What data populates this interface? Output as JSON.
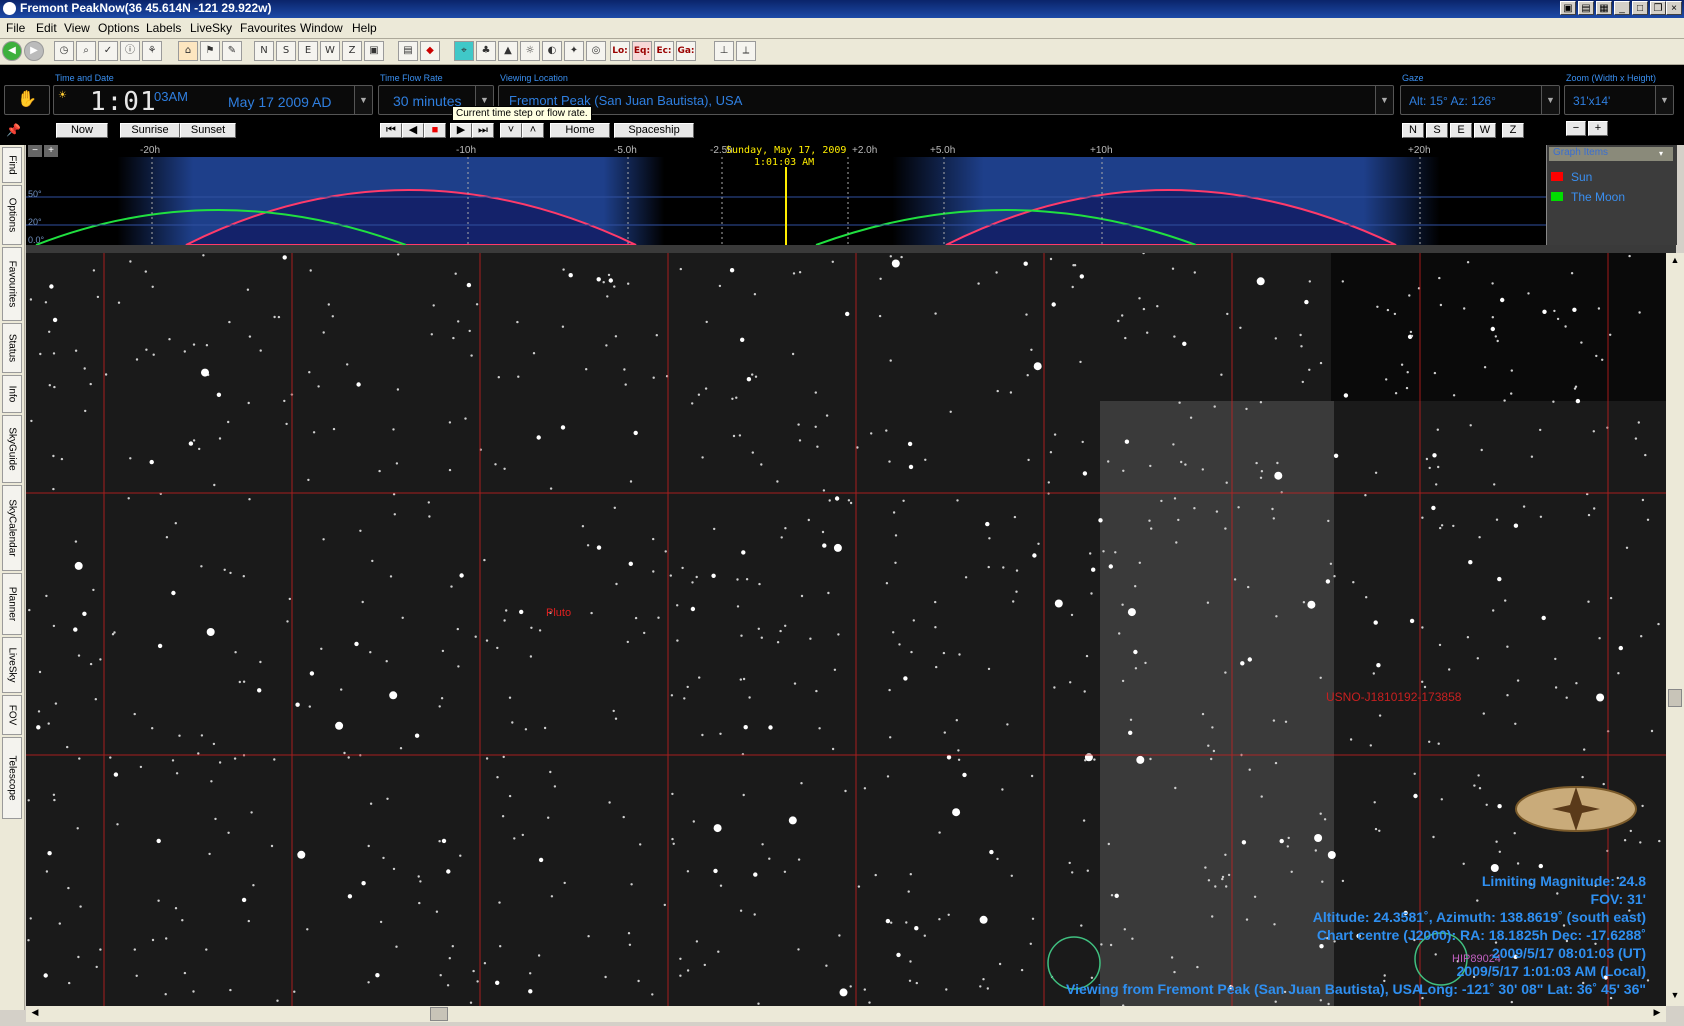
{
  "window": {
    "title": "Fremont PeakNow(36  45.614N -121 29.922w)"
  },
  "menu": [
    "File",
    "Edit",
    "View",
    "Options",
    "Labels",
    "LiveSky",
    "Favourites",
    "Window",
    "Help"
  ],
  "toolbar": {
    "icons": [
      "back-icon",
      "forward-icon",
      "refresh-icon",
      "find-icon",
      "chart-icon",
      "info-icon",
      "telescope-icon",
      "home-icon",
      "flag-icon",
      "edit-icon",
      "refresh2-icon",
      "north-icon",
      "south-icon",
      "east-icon",
      "west-icon",
      "zenith-icon",
      "frame-icon",
      "pic-icon",
      "stop-icon",
      "select-icon",
      "tree-icon",
      "mountain-icon",
      "sun-icon",
      "moon-icon",
      "constellation-icon",
      "galaxy-icon"
    ],
    "text_buttons": [
      "Lo:",
      "Eq:",
      "Ec:",
      "Ga:"
    ]
  },
  "controls": {
    "time_label": "Time and Date",
    "time_value": "1:01",
    "time_suffix": "03AM",
    "date_value": "May 17   2009 AD",
    "flow_label": "Time Flow Rate",
    "flow_value": "30 minutes",
    "flow_tooltip": "Current time step or flow rate.",
    "location_label": "Viewing Location",
    "location_value": "Fremont Peak (San Juan Bautista), USA",
    "gaze_label": "Gaze",
    "gaze_value": "Alt: 15° Az: 126°",
    "zoom_label": "Zoom (Width x Height)",
    "zoom_value": "31'x14'",
    "now": "Now",
    "sunrise": "Sunrise",
    "sunset": "Sunset",
    "home": "Home",
    "spaceship": "Spaceship",
    "compass": [
      "N",
      "S",
      "E",
      "W",
      "Z"
    ],
    "zoom_minus": "−",
    "zoom_plus": "+"
  },
  "sidetabs": [
    "Find",
    "Options",
    "Favourites",
    "Status",
    "Info",
    "SkyGuide",
    "SkyCalendar",
    "Planner",
    "LiveSky",
    "FOV",
    "Telescope"
  ],
  "graph": {
    "ticks": [
      "-20h",
      "-10h",
      "-5.0h",
      "-2.5h",
      "+2.0h",
      "+5.0h",
      "+10h",
      "+20h"
    ],
    "alt_ticks": [
      "50°",
      "20°",
      "0.0°"
    ],
    "current_date": "Sunday, May 17, 2009",
    "current_time": "1:01:03 AM",
    "legend_title": "Graph Items",
    "legend": [
      {
        "name": "Sun",
        "color": "#ff0000"
      },
      {
        "name": "The Moon",
        "color": "#00dd00"
      }
    ]
  },
  "sky": {
    "labels": {
      "pluto": "Pluto",
      "usno": "USNO-J1810192-173858",
      "hip": "HIP89024"
    },
    "info": {
      "limiting": "Limiting Magnitude: 24.8",
      "fov": "FOV: 31'",
      "altaz": "Altitude: 24.3581˚, Azimuth: 138.8619˚ (south east)",
      "centre": "Chart centre (J2000): RA: 18.1825h Dec: -17.6288˚",
      "ut": "2009/5/17 08:01:03 (UT)",
      "local": "2009/5/17 1:01:03 AM (Local)",
      "viewing": "Viewing from Fremont Peak (San Juan Bautista), USA",
      "longlat": "Long: -121˚ 30' 08\"  Lat: 36˚ 45' 36\""
    }
  },
  "colors": {
    "accent": "#2f8ff0",
    "grid": "#c82020",
    "sunCurve": "#ff3060",
    "moonCurve": "#20e040"
  }
}
